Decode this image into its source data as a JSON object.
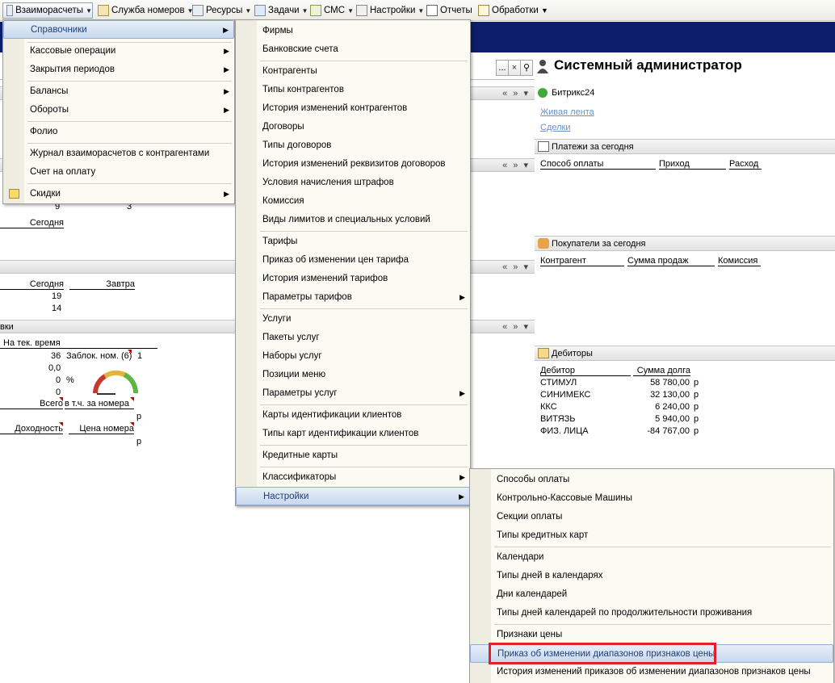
{
  "menubar": {
    "items": [
      {
        "label": "Взаиморасчеты",
        "icon": "calculator-icon",
        "dropdown": true
      },
      {
        "label": "Служба номеров",
        "icon": "clipboard-icon",
        "dropdown": true
      },
      {
        "label": "Ресурсы",
        "icon": "resources-icon",
        "dropdown": true
      },
      {
        "label": "Задачи",
        "icon": "tasks-icon",
        "dropdown": true
      },
      {
        "label": "СМС",
        "icon": "sms-icon",
        "dropdown": true
      },
      {
        "label": "Настройки",
        "icon": "settings-icon",
        "dropdown": true
      },
      {
        "label": "Отчеты",
        "icon": "reports-icon",
        "dropdown": false
      },
      {
        "label": "Обработки",
        "icon": "processing-icon",
        "dropdown": false
      }
    ]
  },
  "left_panel": {
    "search_buttons": [
      "...",
      "×"
    ],
    "row_9": "9",
    "row_3": "3",
    "today_label": "Сегодня",
    "col_today": "Сегодня",
    "col_tomorrow": "Завтра",
    "val_19": "19",
    "val_14": "14",
    "section_partial": "вки",
    "at_time": "На тек. время",
    "v36": "36",
    "blocked": "Заблок. ном. (6)",
    "v1": "1",
    "v00": "0,0",
    "v0": "0",
    "percent": "%",
    "v0b": "0",
    "total": "Всего",
    "incl": "в т.ч. за номера",
    "rub1": "р",
    "profit": "Доходность",
    "room_price": "Цена номера",
    "rub2": "р"
  },
  "right_panel": {
    "admin_name": "Системный администратор",
    "bitrix_title": "Битрикс24",
    "bitrix_links": [
      "Живая лента",
      "Сделки"
    ],
    "payments": {
      "title": "Платежи за сегодня",
      "columns": [
        "Способ оплаты",
        "Приход",
        "Расход"
      ]
    },
    "buyers": {
      "title": "Покупатели за сегодня",
      "columns": [
        "Контрагент",
        "Сумма продаж",
        "Комиссия"
      ]
    },
    "debtors": {
      "title": "Дебиторы",
      "columns": [
        "Дебитор",
        "Сумма долга"
      ],
      "rows": [
        {
          "name": "СТИМУЛ",
          "amount": "58 780,00",
          "cur": "р"
        },
        {
          "name": "СИНИМЕКС",
          "amount": "32 130,00",
          "cur": "р"
        },
        {
          "name": "ККС",
          "amount": "6 240,00",
          "cur": "р"
        },
        {
          "name": "ВИТЯЗЬ",
          "amount": "5 940,00",
          "cur": "р"
        },
        {
          "name": "ФИЗ. ЛИЦА",
          "amount": "-84 767,00",
          "cur": "р"
        }
      ]
    }
  },
  "menu1": {
    "items": [
      {
        "label": "Справочники",
        "sub": true,
        "highlight": true
      },
      {
        "label": "Кассовые операции",
        "sub": true
      },
      {
        "label": "Закрытия периодов",
        "sub": true
      },
      {
        "label": "Балансы",
        "sub": true
      },
      {
        "label": "Обороты",
        "sub": true
      },
      {
        "label": "Фолио",
        "sub": false
      },
      {
        "label": "Журнал взаиморасчетов с контрагентами",
        "sub": false
      },
      {
        "label": "Счет на оплату",
        "sub": false
      },
      {
        "label": "Скидки",
        "sub": true,
        "icon": "discount-icon"
      }
    ]
  },
  "menu2": {
    "items": [
      {
        "label": "Фирмы"
      },
      {
        "label": "Банковские счета"
      },
      {
        "label": "Контрагенты"
      },
      {
        "label": "Типы контрагентов"
      },
      {
        "label": "История изменений контрагентов"
      },
      {
        "label": "Договоры"
      },
      {
        "label": "Типы договоров"
      },
      {
        "label": "История изменений реквизитов договоров"
      },
      {
        "label": "Условия начисления штрафов"
      },
      {
        "label": "Комиссия"
      },
      {
        "label": "Виды лимитов и специальных условий"
      },
      {
        "label": "Тарифы"
      },
      {
        "label": "Приказ об изменении цен тарифа"
      },
      {
        "label": "История изменений тарифов"
      },
      {
        "label": "Параметры тарифов",
        "sub": true
      },
      {
        "label": "Услуги"
      },
      {
        "label": "Пакеты услуг"
      },
      {
        "label": "Наборы услуг"
      },
      {
        "label": "Позиции меню"
      },
      {
        "label": "Параметры услуг",
        "sub": true
      },
      {
        "label": "Карты идентификации клиентов"
      },
      {
        "label": "Типы карт идентификации клиентов"
      },
      {
        "label": "Кредитные карты"
      },
      {
        "label": "Классификаторы",
        "sub": true
      },
      {
        "label": "Настройки",
        "sub": true,
        "highlight": true
      }
    ]
  },
  "menu3": {
    "items": [
      {
        "label": "Способы оплаты"
      },
      {
        "label": "Контрольно-Кассовые Машины"
      },
      {
        "label": "Секции оплаты"
      },
      {
        "label": "Типы кредитных карт"
      },
      {
        "label": "Календари"
      },
      {
        "label": "Типы дней в календарях"
      },
      {
        "label": "Дни календарей"
      },
      {
        "label": "Типы дней календарей по продолжительности проживания"
      },
      {
        "label": "Признаки цены"
      },
      {
        "label": "Приказ об изменении диапазонов признаков цены",
        "highlight": true,
        "annotated": true
      },
      {
        "label": "История изменений приказов об изменении диапазонов признаков цены"
      }
    ]
  },
  "colors": {
    "title_band": "#0c1d6b",
    "menu_bg": "#fcfbf3",
    "menu_highlight": "#c8d8ee",
    "annotation_red": "#e0202b"
  }
}
